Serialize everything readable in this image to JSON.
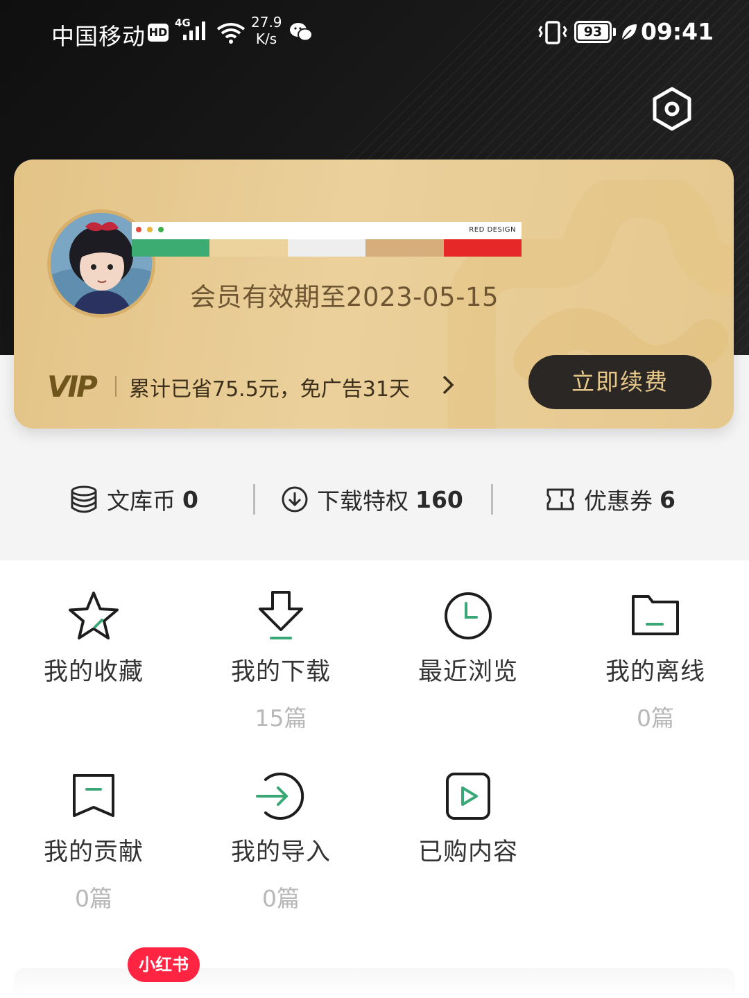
{
  "status_bar": {
    "carrier": "中国移动",
    "hd": "HD",
    "network": "4G",
    "speed_value": "27.9",
    "speed_unit": "K/s",
    "battery": "93",
    "time": "09:41"
  },
  "settings": {
    "icon": "settings-hexagon-icon"
  },
  "vip_card": {
    "banner_brand": "RED DESIGN",
    "banner_colors": [
      "#3dac72",
      "#ecd29c",
      "#eeeeee",
      "#d6ae7c",
      "#e62828"
    ],
    "expiry_text": "会员有效期至2023-05-15",
    "vip_logo": "VIP",
    "savings_text": "累计已省75.5元，免广告31天",
    "renew_label": "立即续费",
    "accent": "#e8c889"
  },
  "stats": [
    {
      "label": "文库币",
      "value": "0",
      "icon": "coins-stack-icon"
    },
    {
      "label": "下载特权",
      "value": "160",
      "icon": "download-circle-icon"
    },
    {
      "label": "优惠券",
      "value": "6",
      "icon": "ticket-icon"
    }
  ],
  "menu": [
    {
      "title": "我的收藏",
      "count": "",
      "icon": "star-icon"
    },
    {
      "title": "我的下载",
      "count": "15篇",
      "icon": "download-icon"
    },
    {
      "title": "最近浏览",
      "count": "",
      "icon": "clock-icon"
    },
    {
      "title": "我的离线",
      "count": "0篇",
      "icon": "folder-icon"
    },
    {
      "title": "我的贡献",
      "count": "0篇",
      "icon": "bookmark-icon"
    },
    {
      "title": "我的导入",
      "count": "0篇",
      "icon": "import-icon"
    },
    {
      "title": "已购内容",
      "count": "",
      "icon": "play-box-icon"
    }
  ],
  "watermark": "小红书",
  "colors": {
    "green_accent": "#3aa876",
    "icon_stroke": "#1d1d1d"
  }
}
